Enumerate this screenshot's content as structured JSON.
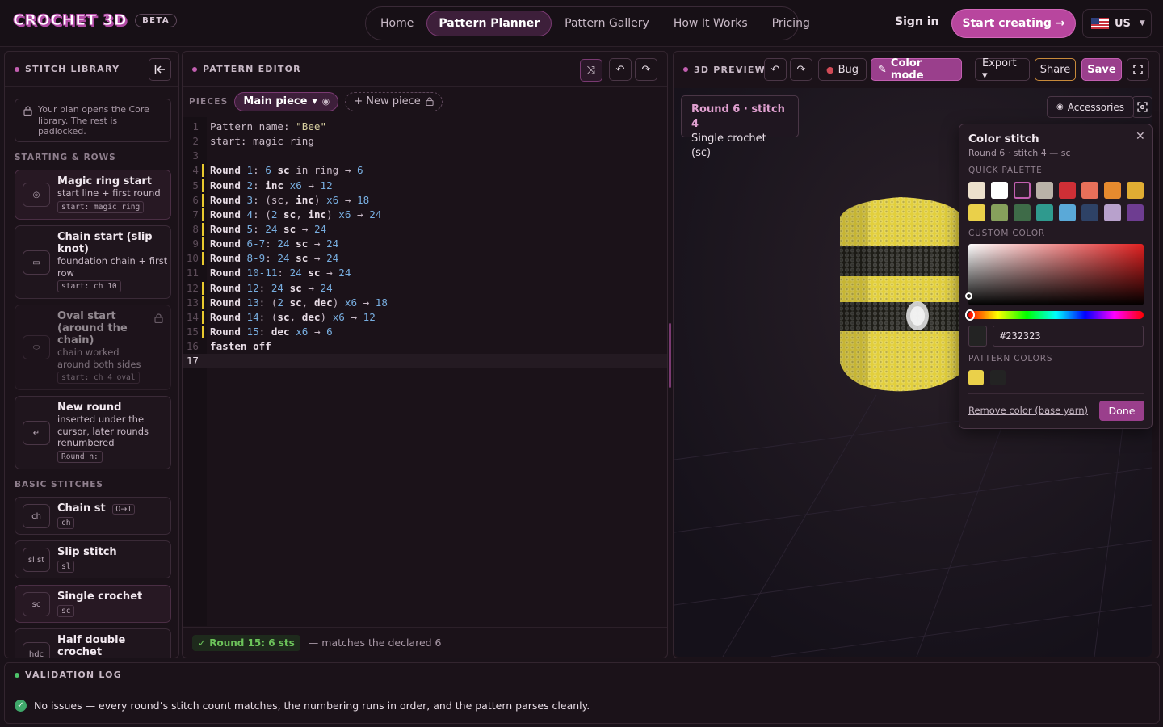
{
  "header": {
    "logo_text": "CROCHET 3D",
    "beta": "BETA",
    "nav": [
      {
        "label": "Home",
        "active": false
      },
      {
        "label": "Pattern Planner",
        "active": true
      },
      {
        "label": "Pattern Gallery",
        "active": false
      },
      {
        "label": "How It Works",
        "active": false
      },
      {
        "label": "Pricing",
        "active": false
      }
    ],
    "sign_in": "Sign in",
    "start_creating": "Start creating →",
    "locale": "US"
  },
  "library": {
    "title": "STITCH LIBRARY",
    "note": "Your plan opens the Core library. The rest is padlocked.",
    "section_starting": "STARTING & ROWS",
    "section_basic": "BASIC STITCHES",
    "starting_cards": [
      {
        "title": "Magic ring start",
        "desc": "start line + first round",
        "code": "start: magic ring",
        "icon": "◎"
      },
      {
        "title": "Chain start (slip knot)",
        "desc": "foundation chain + first row",
        "code": "start: ch 10",
        "icon": "▭"
      },
      {
        "title": "Oval start (around the chain)",
        "desc": "chain worked around both sides",
        "code": "start: ch 4 oval",
        "icon": "⬭"
      },
      {
        "title": "New round",
        "desc": "inserted under the cursor, later rounds renumbered",
        "code": "Round n:",
        "icon": "↵"
      }
    ],
    "basic_cards": [
      {
        "title": "Chain st",
        "tag": "0→1",
        "code": "ch",
        "icon": "ch"
      },
      {
        "title": "Slip stitch",
        "code": "sl",
        "icon": "sl st"
      },
      {
        "title": "Single crochet",
        "code": "sc",
        "icon": "sc"
      },
      {
        "title": "Half double crochet",
        "code": "hdc",
        "icon": "hdc"
      }
    ]
  },
  "editor": {
    "title": "PATTERN EDITOR",
    "pieces_label": "PIECES",
    "main_piece": "Main piece",
    "new_piece": "+ New piece",
    "lines": [
      {
        "n": "1",
        "mark": false,
        "parts": [
          [
            "lbl",
            "Pattern name: "
          ],
          [
            "str",
            "\"Bee\""
          ]
        ]
      },
      {
        "n": "2",
        "mark": false,
        "parts": [
          [
            "lbl",
            "start: "
          ],
          [
            "lbl",
            "magic ring"
          ]
        ]
      },
      {
        "n": "3",
        "mark": false,
        "parts": []
      },
      {
        "n": "4",
        "mark": true,
        "parts": [
          [
            "bold",
            "Round "
          ],
          [
            "num",
            "1"
          ],
          [
            "lbl",
            ": "
          ],
          [
            "num",
            "6 "
          ],
          [
            "bold",
            "sc "
          ],
          [
            "lbl",
            "in ring "
          ],
          [
            "lbl",
            "→ "
          ],
          [
            "num",
            "6"
          ]
        ]
      },
      {
        "n": "5",
        "mark": true,
        "parts": [
          [
            "bold",
            "Round "
          ],
          [
            "num",
            "2"
          ],
          [
            "lbl",
            ": "
          ],
          [
            "bold",
            "inc "
          ],
          [
            "num",
            "x6 "
          ],
          [
            "lbl",
            "→ "
          ],
          [
            "num",
            "12"
          ]
        ]
      },
      {
        "n": "6",
        "mark": true,
        "parts": [
          [
            "bold",
            "Round "
          ],
          [
            "num",
            "3"
          ],
          [
            "lbl",
            ": (sc, "
          ],
          [
            "bold",
            "inc"
          ],
          [
            "lbl",
            ") "
          ],
          [
            "num",
            "x6 "
          ],
          [
            "lbl",
            "→ "
          ],
          [
            "num",
            "18"
          ]
        ]
      },
      {
        "n": "7",
        "mark": true,
        "parts": [
          [
            "bold",
            "Round "
          ],
          [
            "num",
            "4"
          ],
          [
            "lbl",
            ": ("
          ],
          [
            "num",
            "2 "
          ],
          [
            "bold",
            "sc"
          ],
          [
            "lbl",
            ", "
          ],
          [
            "bold",
            "inc"
          ],
          [
            "lbl",
            ") "
          ],
          [
            "num",
            "x6 "
          ],
          [
            "lbl",
            "→ "
          ],
          [
            "num",
            "24"
          ]
        ]
      },
      {
        "n": "8",
        "mark": true,
        "parts": [
          [
            "bold",
            "Round "
          ],
          [
            "num",
            "5"
          ],
          [
            "lbl",
            ": "
          ],
          [
            "num",
            "24 "
          ],
          [
            "bold",
            "sc "
          ],
          [
            "lbl",
            "→ "
          ],
          [
            "num",
            "24"
          ]
        ]
      },
      {
        "n": "9",
        "mark": true,
        "parts": [
          [
            "bold",
            "Round "
          ],
          [
            "num",
            "6-7"
          ],
          [
            "lbl",
            ": "
          ],
          [
            "num",
            "24 "
          ],
          [
            "bold",
            "sc "
          ],
          [
            "lbl",
            "→ "
          ],
          [
            "num",
            "24"
          ]
        ]
      },
      {
        "n": "10",
        "mark": true,
        "parts": [
          [
            "bold",
            "Round "
          ],
          [
            "num",
            "8-9"
          ],
          [
            "lbl",
            ": "
          ],
          [
            "num",
            "24 "
          ],
          [
            "bold",
            "sc "
          ],
          [
            "lbl",
            "→ "
          ],
          [
            "num",
            "24"
          ]
        ]
      },
      {
        "n": "11",
        "mark": false,
        "parts": [
          [
            "bold",
            "Round "
          ],
          [
            "num",
            "10-11"
          ],
          [
            "lbl",
            ": "
          ],
          [
            "num",
            "24 "
          ],
          [
            "bold",
            "sc "
          ],
          [
            "lbl",
            "→ "
          ],
          [
            "num",
            "24"
          ]
        ]
      },
      {
        "n": "12",
        "mark": true,
        "parts": [
          [
            "bold",
            "Round "
          ],
          [
            "num",
            "12"
          ],
          [
            "lbl",
            ": "
          ],
          [
            "num",
            "24 "
          ],
          [
            "bold",
            "sc "
          ],
          [
            "lbl",
            "→ "
          ],
          [
            "num",
            "24"
          ]
        ]
      },
      {
        "n": "13",
        "mark": true,
        "parts": [
          [
            "bold",
            "Round "
          ],
          [
            "num",
            "13"
          ],
          [
            "lbl",
            ": ("
          ],
          [
            "num",
            "2 "
          ],
          [
            "bold",
            "sc"
          ],
          [
            "lbl",
            ", "
          ],
          [
            "bold",
            "dec"
          ],
          [
            "lbl",
            ") "
          ],
          [
            "num",
            "x6 "
          ],
          [
            "lbl",
            "→ "
          ],
          [
            "num",
            "18"
          ]
        ]
      },
      {
        "n": "14",
        "mark": true,
        "parts": [
          [
            "bold",
            "Round "
          ],
          [
            "num",
            "14"
          ],
          [
            "lbl",
            ": ("
          ],
          [
            "bold",
            "sc"
          ],
          [
            "lbl",
            ", "
          ],
          [
            "bold",
            "dec"
          ],
          [
            "lbl",
            ") "
          ],
          [
            "num",
            "x6 "
          ],
          [
            "lbl",
            "→ "
          ],
          [
            "num",
            "12"
          ]
        ]
      },
      {
        "n": "15",
        "mark": true,
        "parts": [
          [
            "bold",
            "Round "
          ],
          [
            "num",
            "15"
          ],
          [
            "lbl",
            ": "
          ],
          [
            "bold",
            "dec "
          ],
          [
            "num",
            "x6 "
          ],
          [
            "lbl",
            "→ "
          ],
          [
            "num",
            "6"
          ]
        ]
      },
      {
        "n": "16",
        "mark": false,
        "parts": [
          [
            "bold",
            "fasten off"
          ]
        ]
      },
      {
        "n": "17",
        "mark": false,
        "cur": true,
        "parts": []
      }
    ],
    "status_chip": "✓ Round 15: 6 sts",
    "status_text": "— matches the declared 6"
  },
  "preview": {
    "title": "3D PREVIEW",
    "bug": "Bug",
    "color_mode": "Color mode",
    "export": "Export ▾",
    "share": "Share",
    "save": "Save",
    "info_title": "Round 6 · stitch 4",
    "info_sub": "Single crochet (sc)",
    "accessories": "Accessories"
  },
  "color_stitch": {
    "title": "Color stitch",
    "subtitle": "Round 6 · stitch 4 — sc",
    "quick_palette": "QUICK PALETTE",
    "custom_color": "CUSTOM COLOR",
    "pattern_colors": "PATTERN COLORS",
    "hex": "#232323",
    "remove": "Remove color (base yarn)",
    "done": "Done",
    "palette": [
      "#ece0cc",
      "#ffffff",
      "#2b1d2a",
      "#b9b2a8",
      "#cf2f36",
      "#e8705a",
      "#e68a2e",
      "#e0ad33",
      "#ead04a",
      "#87a05c",
      "#3e6b48",
      "#2f9a8e",
      "#5aa9d8",
      "#2e4266",
      "#b8a1cc",
      "#6e3d91"
    ],
    "pattern_swatches": [
      "#ead04a",
      "#232323"
    ]
  },
  "validation": {
    "title": "VALIDATION LOG",
    "message": "No issues — every round’s stitch count matches, the numbering runs in order, and the pattern parses cleanly."
  }
}
